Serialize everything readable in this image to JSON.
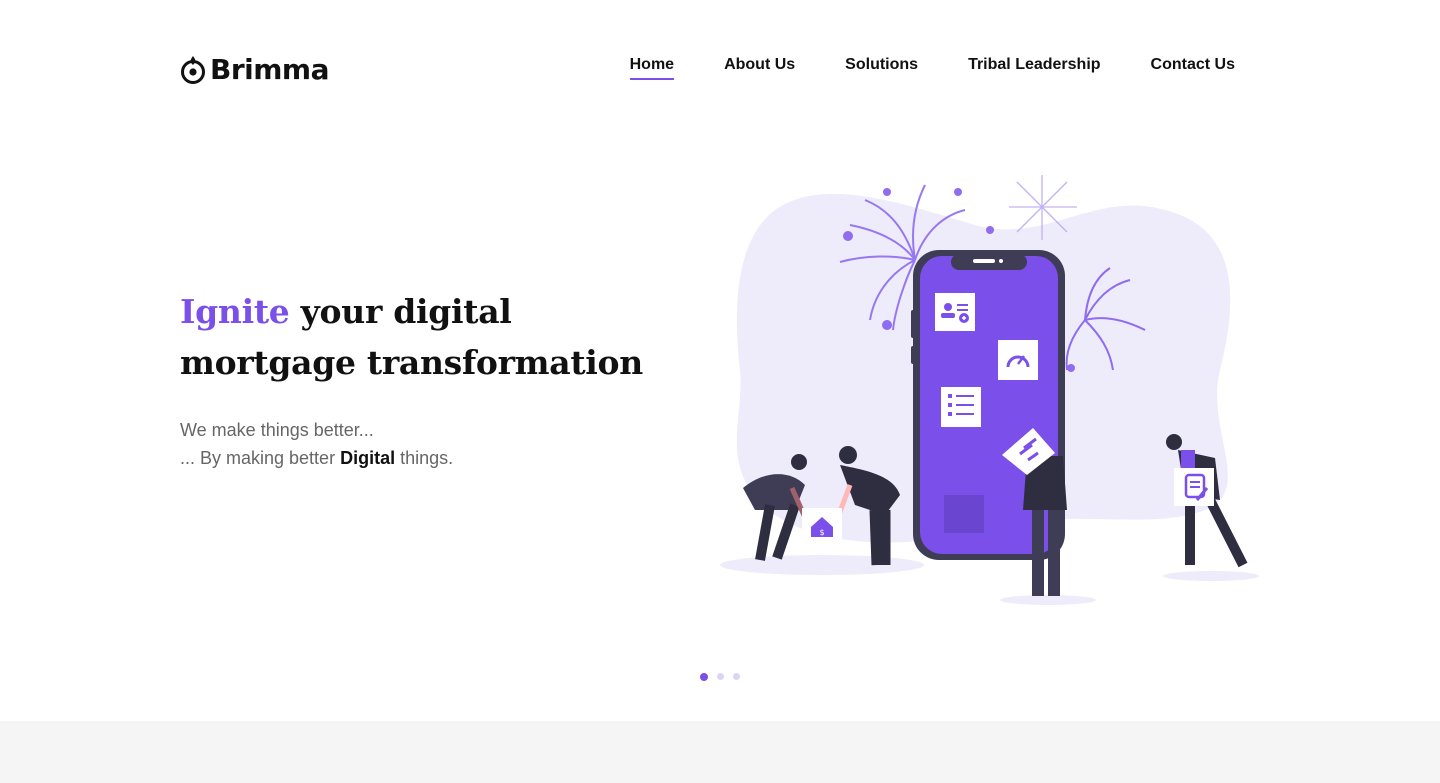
{
  "brand": {
    "name": "Brimma",
    "accent_color": "#7B4FE9"
  },
  "nav": {
    "items": [
      {
        "label": "Home",
        "active": true
      },
      {
        "label": "About Us",
        "active": false
      },
      {
        "label": "Solutions",
        "active": false
      },
      {
        "label": "Tribal Leadership",
        "active": false
      },
      {
        "label": "Contact Us",
        "active": false
      }
    ]
  },
  "hero": {
    "headline_accent": "Ignite",
    "headline_rest_line1": " your digital",
    "headline_line2": "mortgage transformation",
    "sub_line1": "We make things better...",
    "sub_line2_prefix": "... By making better ",
    "sub_line2_bold": "Digital",
    "sub_line2_suffix": " things."
  },
  "carousel": {
    "slides": 3,
    "active_index": 0
  },
  "illustration": {
    "icons": [
      "user-card-icon",
      "speedometer-icon",
      "checklist-icon",
      "house-dollar-icon",
      "document-edit-icon"
    ]
  }
}
